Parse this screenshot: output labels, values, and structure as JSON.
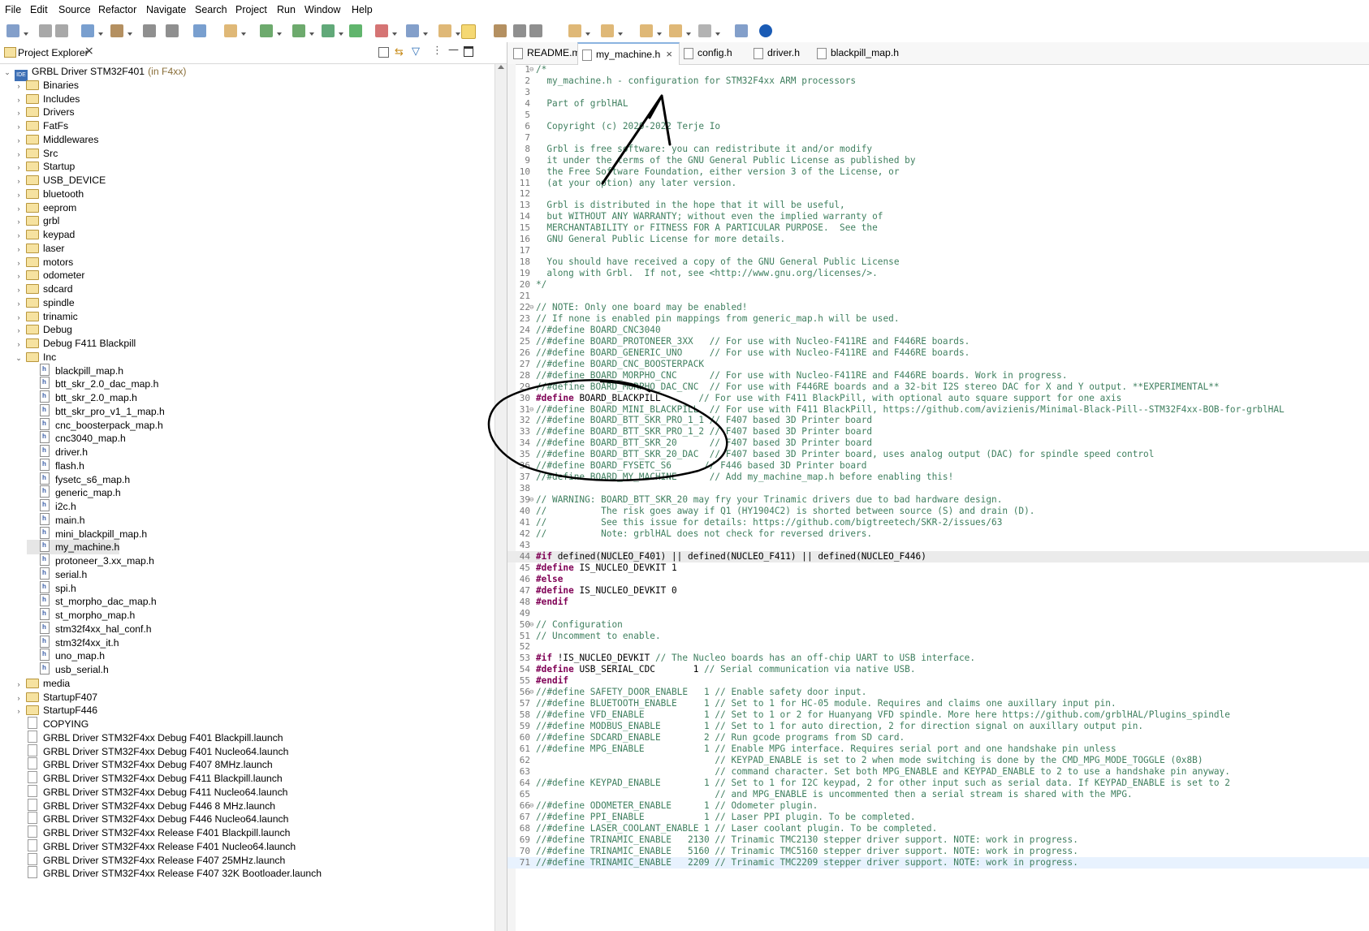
{
  "menu": [
    "File",
    "Edit",
    "Source",
    "Refactor",
    "Navigate",
    "Search",
    "Project",
    "Run",
    "Window",
    "Help"
  ],
  "toolbar_icons": [
    "new-icon",
    "save-icon",
    "save-all-icon",
    "build-icon",
    "hammer-icon",
    "binary-icon",
    "debug-icon",
    "run-icon",
    "external-tools-icon",
    "new-class-icon",
    "search-icon",
    "mark-occurrences-icon",
    "toggle-whitespace-icon",
    "next-annotation-icon",
    "prev-annotation-icon",
    "back-icon",
    "forward-icon",
    "perspective-icon",
    "info-icon"
  ],
  "explorer": {
    "title": "Project Explorer",
    "project": "GRBL Driver STM32F401",
    "project_suffix": "(in F4xx)",
    "project_badge": "IDE",
    "folders": [
      "Binaries",
      "Includes",
      "Drivers",
      "FatFs",
      "Middlewares",
      "Src",
      "Startup",
      "USB_DEVICE",
      "bluetooth",
      "eeprom",
      "grbl",
      "keypad",
      "laser",
      "motors",
      "odometer",
      "sdcard",
      "spindle",
      "trinamic",
      "Debug",
      "Debug F411 Blackpill"
    ],
    "open_folder": "Inc",
    "inc_files": [
      "blackpill_map.h",
      "btt_skr_2.0_dac_map.h",
      "btt_skr_2.0_map.h",
      "btt_skr_pro_v1_1_map.h",
      "cnc_boosterpack_map.h",
      "cnc3040_map.h",
      "driver.h",
      "flash.h",
      "fysetc_s6_map.h",
      "generic_map.h",
      "i2c.h",
      "main.h",
      "mini_blackpill_map.h",
      "my_machine.h",
      "protoneer_3.xx_map.h",
      "serial.h",
      "spi.h",
      "st_morpho_dac_map.h",
      "st_morpho_map.h",
      "stm32f4xx_hal_conf.h",
      "stm32f4xx_it.h",
      "uno_map.h",
      "usb_serial.h"
    ],
    "selected_file": "my_machine.h",
    "after_folders": [
      "media",
      "StartupF407",
      "StartupF446"
    ],
    "files": [
      "COPYING",
      "GRBL Driver STM32F4xx Debug F401 Blackpill.launch",
      "GRBL Driver STM32F4xx Debug F401 Nucleo64.launch",
      "GRBL Driver STM32F4xx Debug F407 8MHz.launch",
      "GRBL Driver STM32F4xx Debug F411 Blackpill.launch",
      "GRBL Driver STM32F4xx Debug F411 Nucleo64.launch",
      "GRBL Driver STM32F4xx Debug F446 8 MHz.launch",
      "GRBL Driver STM32F4xx Debug F446 Nucleo64.launch",
      "GRBL Driver STM32F4xx Release F401 Blackpill.launch",
      "GRBL Driver STM32F4xx Release F401 Nucleo64.launch",
      "GRBL Driver STM32F4xx Release F407 25MHz.launch",
      "GRBL Driver STM32F4xx Release F407 32K Bootloader.launch"
    ]
  },
  "tabs": [
    {
      "label": "README.md",
      "active": false
    },
    {
      "label": "my_machine.h",
      "active": true
    },
    {
      "label": "config.h",
      "active": false
    },
    {
      "label": "driver.h",
      "active": false
    },
    {
      "label": "blackpill_map.h",
      "active": false
    }
  ],
  "code_lines": [
    {
      "n": "1",
      "fold": "⊖",
      "segs": [
        [
          "c",
          "/*"
        ]
      ]
    },
    {
      "n": "2",
      "segs": [
        [
          "c",
          "  my_machine.h - configuration for STM32F4xx ARM processors"
        ]
      ]
    },
    {
      "n": "3",
      "segs": [
        [
          "c",
          ""
        ]
      ]
    },
    {
      "n": "4",
      "segs": [
        [
          "c",
          "  Part of grblHAL"
        ]
      ]
    },
    {
      "n": "5",
      "segs": [
        [
          "c",
          ""
        ]
      ]
    },
    {
      "n": "6",
      "segs": [
        [
          "c",
          "  Copyright (c) 2020-2022 Terje Io"
        ]
      ]
    },
    {
      "n": "7",
      "segs": [
        [
          "c",
          ""
        ]
      ]
    },
    {
      "n": "8",
      "segs": [
        [
          "c",
          "  Grbl is free software: you can redistribute it and/or modify"
        ]
      ]
    },
    {
      "n": "9",
      "segs": [
        [
          "c",
          "  it under the terms of the GNU General Public License as published by"
        ]
      ]
    },
    {
      "n": "10",
      "segs": [
        [
          "c",
          "  the Free Software Foundation, either version 3 of the License, or"
        ]
      ]
    },
    {
      "n": "11",
      "segs": [
        [
          "c",
          "  (at your option) any later version."
        ]
      ]
    },
    {
      "n": "12",
      "segs": [
        [
          "c",
          ""
        ]
      ]
    },
    {
      "n": "13",
      "segs": [
        [
          "c",
          "  Grbl is distributed in the hope that it will be useful,"
        ]
      ]
    },
    {
      "n": "14",
      "segs": [
        [
          "c",
          "  but WITHOUT ANY WARRANTY; without even the implied warranty of"
        ]
      ]
    },
    {
      "n": "15",
      "segs": [
        [
          "c",
          "  MERCHANTABILITY or FITNESS FOR A PARTICULAR PURPOSE.  See the"
        ]
      ]
    },
    {
      "n": "16",
      "segs": [
        [
          "c",
          "  GNU General Public License for more details."
        ]
      ]
    },
    {
      "n": "17",
      "segs": [
        [
          "c",
          ""
        ]
      ]
    },
    {
      "n": "18",
      "segs": [
        [
          "c",
          "  You should have received a copy of the GNU General Public License"
        ]
      ]
    },
    {
      "n": "19",
      "segs": [
        [
          "c",
          "  along with Grbl.  If not, see <http://www.gnu.org/licenses/>."
        ]
      ]
    },
    {
      "n": "20",
      "segs": [
        [
          "c",
          "*/"
        ]
      ]
    },
    {
      "n": "21",
      "segs": [
        [
          "c",
          ""
        ]
      ]
    },
    {
      "n": "22",
      "fold": "⊖",
      "segs": [
        [
          "c",
          "// NOTE: Only one board may be enabled!"
        ]
      ]
    },
    {
      "n": "23",
      "segs": [
        [
          "c",
          "// If none is enabled pin mappings from generic_map.h will be used."
        ]
      ]
    },
    {
      "n": "24",
      "segs": [
        [
          "c",
          "//#define BOARD_CNC3040"
        ]
      ]
    },
    {
      "n": "25",
      "segs": [
        [
          "c",
          "//#define BOARD_PROTONEER_3XX   // For use with Nucleo-F411RE and F446RE boards."
        ]
      ]
    },
    {
      "n": "26",
      "segs": [
        [
          "c",
          "//#define BOARD_GENERIC_UNO     // For use with Nucleo-F411RE and F446RE boards."
        ]
      ]
    },
    {
      "n": "27",
      "segs": [
        [
          "c",
          "//#define BOARD_CNC_BOOSTERPACK"
        ]
      ]
    },
    {
      "n": "28",
      "segs": [
        [
          "c",
          "//#define BOARD_MORPHO_CNC      // For use with Nucleo-F411RE and F446RE boards. Work in progress."
        ]
      ]
    },
    {
      "n": "29",
      "segs": [
        [
          "c",
          "//#define BOARD_MORPHO_DAC_CNC  // For use with F446RE boards and a 32-bit I2S stereo DAC for X and Y output. **EXPERIMENTAL**"
        ]
      ]
    },
    {
      "n": "30",
      "segs": [
        [
          "d",
          "#define"
        ],
        [
          "p",
          " BOARD_BLACKPILL       "
        ],
        [
          "c",
          "// For use with F411 BlackPill, with optional auto square support for one axis"
        ]
      ]
    },
    {
      "n": "31",
      "fold": "⊖",
      "segs": [
        [
          "c",
          "//#define BOARD_MINI_BLACKPILL  // For use with F411 BlackPill, https://github.com/avizienis/Minimal-Black-Pill--STM32F4xx-BOB-for-grblHAL"
        ]
      ]
    },
    {
      "n": "32",
      "segs": [
        [
          "c",
          "//#define BOARD_BTT_SKR_PRO_1_1 // F407 based 3D Printer board"
        ]
      ]
    },
    {
      "n": "33",
      "segs": [
        [
          "c",
          "//#define BOARD_BTT_SKR_PRO_1_2 // F407 based 3D Printer board"
        ]
      ]
    },
    {
      "n": "34",
      "segs": [
        [
          "c",
          "//#define BOARD_BTT_SKR_20      // F407 based 3D Printer board"
        ]
      ]
    },
    {
      "n": "35",
      "segs": [
        [
          "c",
          "//#define BOARD_BTT_SKR_20_DAC  // F407 based 3D Printer board, uses analog output (DAC) for spindle speed control"
        ]
      ]
    },
    {
      "n": "36",
      "segs": [
        [
          "c",
          "//#define BOARD_FYSETC_S6      // F446 based 3D Printer board"
        ]
      ]
    },
    {
      "n": "37",
      "segs": [
        [
          "c",
          "//#define BOARD_MY_MACHINE      // Add my_machine_map.h before enabling this!"
        ]
      ]
    },
    {
      "n": "38",
      "segs": [
        [
          "c",
          ""
        ]
      ]
    },
    {
      "n": "39",
      "fold": "⊖",
      "segs": [
        [
          "c",
          "// WARNING: BOARD_BTT_SKR_20 may fry your Trinamic drivers due to bad hardware design."
        ]
      ]
    },
    {
      "n": "40",
      "segs": [
        [
          "c",
          "//          The risk goes away if Q1 (HY1904C2) is shorted between source (S) and drain (D)."
        ]
      ]
    },
    {
      "n": "41",
      "segs": [
        [
          "c",
          "//          See this issue for details: https://github.com/bigtreetech/SKR-2/issues/63"
        ]
      ]
    },
    {
      "n": "42",
      "segs": [
        [
          "c",
          "//          Note: grblHAL does not check for reversed drivers."
        ]
      ]
    },
    {
      "n": "43",
      "segs": [
        [
          "c",
          ""
        ]
      ]
    },
    {
      "n": "44",
      "hl": "hl2",
      "segs": [
        [
          "d",
          "#if"
        ],
        [
          "p",
          " defined(NUCLEO_F401) || defined(NUCLEO_F411) || defined(NUCLEO_F446)"
        ]
      ]
    },
    {
      "n": "45",
      "segs": [
        [
          "d",
          "#define"
        ],
        [
          "p",
          " IS_NUCLEO_DEVKIT 1"
        ]
      ]
    },
    {
      "n": "46",
      "segs": [
        [
          "d",
          "#else"
        ]
      ]
    },
    {
      "n": "47",
      "segs": [
        [
          "d",
          "#define"
        ],
        [
          "p",
          " IS_NUCLEO_DEVKIT 0"
        ]
      ]
    },
    {
      "n": "48",
      "segs": [
        [
          "d",
          "#endif"
        ]
      ]
    },
    {
      "n": "49",
      "segs": [
        [
          "c",
          ""
        ]
      ]
    },
    {
      "n": "50",
      "fold": "⊖",
      "segs": [
        [
          "c",
          "// Configuration"
        ]
      ]
    },
    {
      "n": "51",
      "segs": [
        [
          "c",
          "// Uncomment to enable."
        ]
      ]
    },
    {
      "n": "52",
      "segs": [
        [
          "c",
          ""
        ]
      ]
    },
    {
      "n": "53",
      "segs": [
        [
          "d",
          "#if"
        ],
        [
          "p",
          " !IS_NUCLEO_DEVKIT "
        ],
        [
          "c",
          "// The Nucleo boards has an off-chip UART to USB interface."
        ]
      ]
    },
    {
      "n": "54",
      "segs": [
        [
          "d",
          "#define"
        ],
        [
          "p",
          " USB_SERIAL_CDC       1 "
        ],
        [
          "c",
          "// Serial communication via native USB."
        ]
      ]
    },
    {
      "n": "55",
      "segs": [
        [
          "d",
          "#endif"
        ]
      ]
    },
    {
      "n": "56",
      "fold": "⊖",
      "segs": [
        [
          "c",
          "//#define SAFETY_DOOR_ENABLE   1 // Enable safety door input."
        ]
      ]
    },
    {
      "n": "57",
      "segs": [
        [
          "c",
          "//#define BLUETOOTH_ENABLE     1 // Set to 1 for HC-05 module. Requires and claims one auxillary input pin."
        ]
      ]
    },
    {
      "n": "58",
      "segs": [
        [
          "c",
          "//#define VFD_ENABLE           1 // Set to 1 or 2 for Huanyang VFD spindle. More here https://github.com/grblHAL/Plugins_spindle"
        ]
      ]
    },
    {
      "n": "59",
      "segs": [
        [
          "c",
          "//#define MODBUS_ENABLE        1 // Set to 1 for auto direction, 2 for direction signal on auxillary output pin."
        ]
      ]
    },
    {
      "n": "60",
      "segs": [
        [
          "c",
          "//#define SDCARD_ENABLE        2 // Run gcode programs from SD card."
        ]
      ]
    },
    {
      "n": "61",
      "segs": [
        [
          "c",
          "//#define MPG_ENABLE           1 // Enable MPG interface. Requires serial port and one handshake pin unless"
        ]
      ]
    },
    {
      "n": "62",
      "segs": [
        [
          "c",
          "                                 // KEYPAD_ENABLE is set to 2 when mode switching is done by the CMD_MPG_MODE_TOGGLE (0x8B)"
        ]
      ]
    },
    {
      "n": "63",
      "segs": [
        [
          "c",
          "                                 // command character. Set both MPG_ENABLE and KEYPAD_ENABLE to 2 to use a handshake pin anyway."
        ]
      ]
    },
    {
      "n": "64",
      "segs": [
        [
          "c",
          "//#define KEYPAD_ENABLE        1 // Set to 1 for I2C keypad, 2 for other input such as serial data. If KEYPAD_ENABLE is set to 2"
        ]
      ]
    },
    {
      "n": "65",
      "segs": [
        [
          "c",
          "                                 // and MPG_ENABLE is uncommented then a serial stream is shared with the MPG."
        ]
      ]
    },
    {
      "n": "66",
      "fold": "⊖",
      "segs": [
        [
          "c",
          "//#define ODOMETER_ENABLE      1 // Odometer plugin."
        ]
      ]
    },
    {
      "n": "67",
      "segs": [
        [
          "c",
          "//#define PPI_ENABLE           1 // Laser PPI plugin. To be completed."
        ]
      ]
    },
    {
      "n": "68",
      "segs": [
        [
          "c",
          "//#define LASER_COOLANT_ENABLE 1 // Laser coolant plugin. To be completed."
        ]
      ]
    },
    {
      "n": "69",
      "segs": [
        [
          "c",
          "//#define TRINAMIC_ENABLE   2130 // Trinamic TMC2130 stepper driver support. NOTE: work in progress."
        ]
      ]
    },
    {
      "n": "70",
      "segs": [
        [
          "c",
          "//#define TRINAMIC_ENABLE   5160 // Trinamic TMC5160 stepper driver support. NOTE: work in progress."
        ]
      ]
    },
    {
      "n": "71",
      "hl": "hl",
      "segs": [
        [
          "c",
          "//#define TRINAMIC_ENABLE   2209 // Trinamic TMC2209 stepper driver support. NOTE: work in progress."
        ]
      ]
    }
  ],
  "colors": {
    "comment": "#3f7f5f",
    "directive": "#7f0055",
    "accent": "#8bb3e0"
  }
}
